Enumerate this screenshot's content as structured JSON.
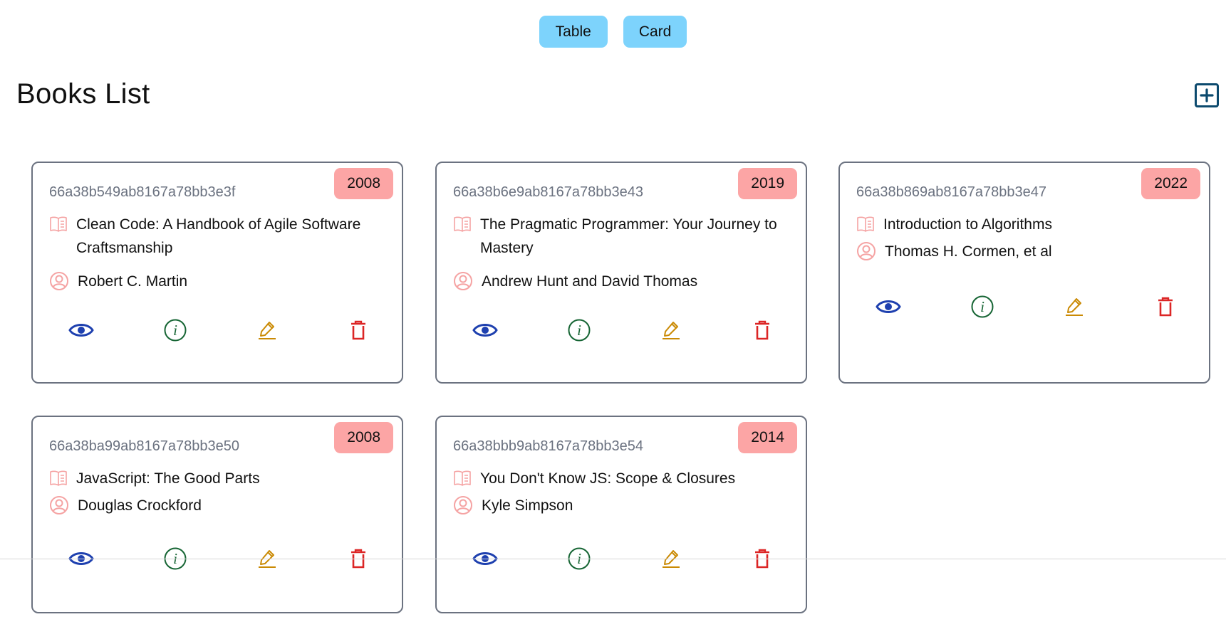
{
  "view_toggle": {
    "table_label": "Table",
    "card_label": "Card"
  },
  "page_title": "Books List",
  "add_button": {
    "icon": "plus-square-icon",
    "color": "#0c4a6e"
  },
  "colors": {
    "toggle_bg": "#7dd3fc",
    "year_badge_bg": "#fca5a5",
    "book_icon": "#f5a3a3",
    "view_icon": "#1e40af",
    "info_icon": "#166534",
    "edit_icon": "#ca8a04",
    "delete_icon": "#dc2626",
    "card_border": "#6b7280"
  },
  "books": [
    {
      "id": "66a38b549ab8167a78bb3e3f",
      "year": "2008",
      "title": "Clean Code: A Handbook of Agile Software Craftsmanship",
      "author": "Robert C. Martin"
    },
    {
      "id": "66a38b6e9ab8167a78bb3e43",
      "year": "2019",
      "title": "The Pragmatic Programmer: Your Journey to Mastery",
      "author": "Andrew Hunt and David Thomas"
    },
    {
      "id": "66a38b869ab8167a78bb3e47",
      "year": "2022",
      "title": "Introduction to Algorithms",
      "author": "Thomas H. Cormen, et al"
    },
    {
      "id": "66a38ba99ab8167a78bb3e50",
      "year": "2008",
      "title": "JavaScript: The Good Parts",
      "author": "Douglas Crockford"
    },
    {
      "id": "66a38bbb9ab8167a78bb3e54",
      "year": "2014",
      "title": "You Don't Know JS: Scope & Closures",
      "author": "Kyle Simpson"
    }
  ],
  "card_actions": [
    {
      "name": "view",
      "icon": "eye-icon"
    },
    {
      "name": "info",
      "icon": "info-circle-icon"
    },
    {
      "name": "edit",
      "icon": "pencil-icon"
    },
    {
      "name": "delete",
      "icon": "trash-icon"
    }
  ]
}
